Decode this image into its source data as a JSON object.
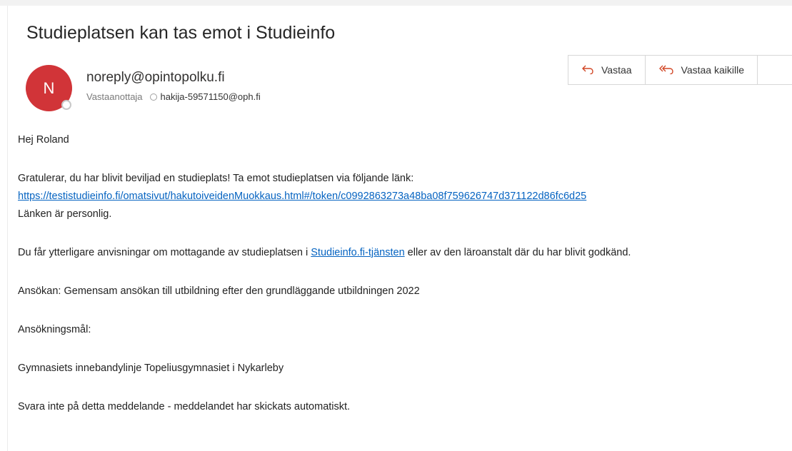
{
  "email": {
    "subject": "Studieplatsen kan tas emot i Studieinfo",
    "avatar_initial": "N",
    "sender": "noreply@opintopolku.fi",
    "recipient_label": "Vastaanottaja",
    "recipient": "hakija-59571150@oph.fi"
  },
  "toolbar": {
    "reply_label": "Vastaa",
    "reply_all_label": "Vastaa kaikille"
  },
  "body": {
    "greeting": "Hej Roland",
    "congrats": "Gratulerar, du har blivit beviljad en studieplats! Ta emot studieplatsen via följande länk:",
    "link_url": "https://testistudieinfo.fi/omatsivut/hakutoiveidenMuokkaus.html#/token/c0992863273a48ba08f759626747d371122d86fc6d25",
    "personal_note": "Länken är personlig.",
    "info_prefix": "Du får ytterligare anvisningar om mottagande av studieplatsen i ",
    "info_link": "Studieinfo.fi-tjänsten",
    "info_suffix": " eller av den läroanstalt där du har blivit godkänd.",
    "application": "Ansökan: Gemensam ansökan till utbildning efter den grundläggande utbildningen 2022",
    "goals_label": "Ansökningsmål:",
    "goal": "Gymnasiets innebandylinje Topeliusgymnasiet i Nykarleby",
    "footer": "Svara inte på detta meddelande - meddelandet har skickats automatiskt."
  },
  "icons": {
    "reply": "reply-arrow-icon",
    "reply_all": "reply-all-arrow-icon",
    "presence": "presence-status-icon"
  },
  "colors": {
    "avatar": "#d13438",
    "link": "#0563c1",
    "toolbar_icon": "#d24726"
  }
}
